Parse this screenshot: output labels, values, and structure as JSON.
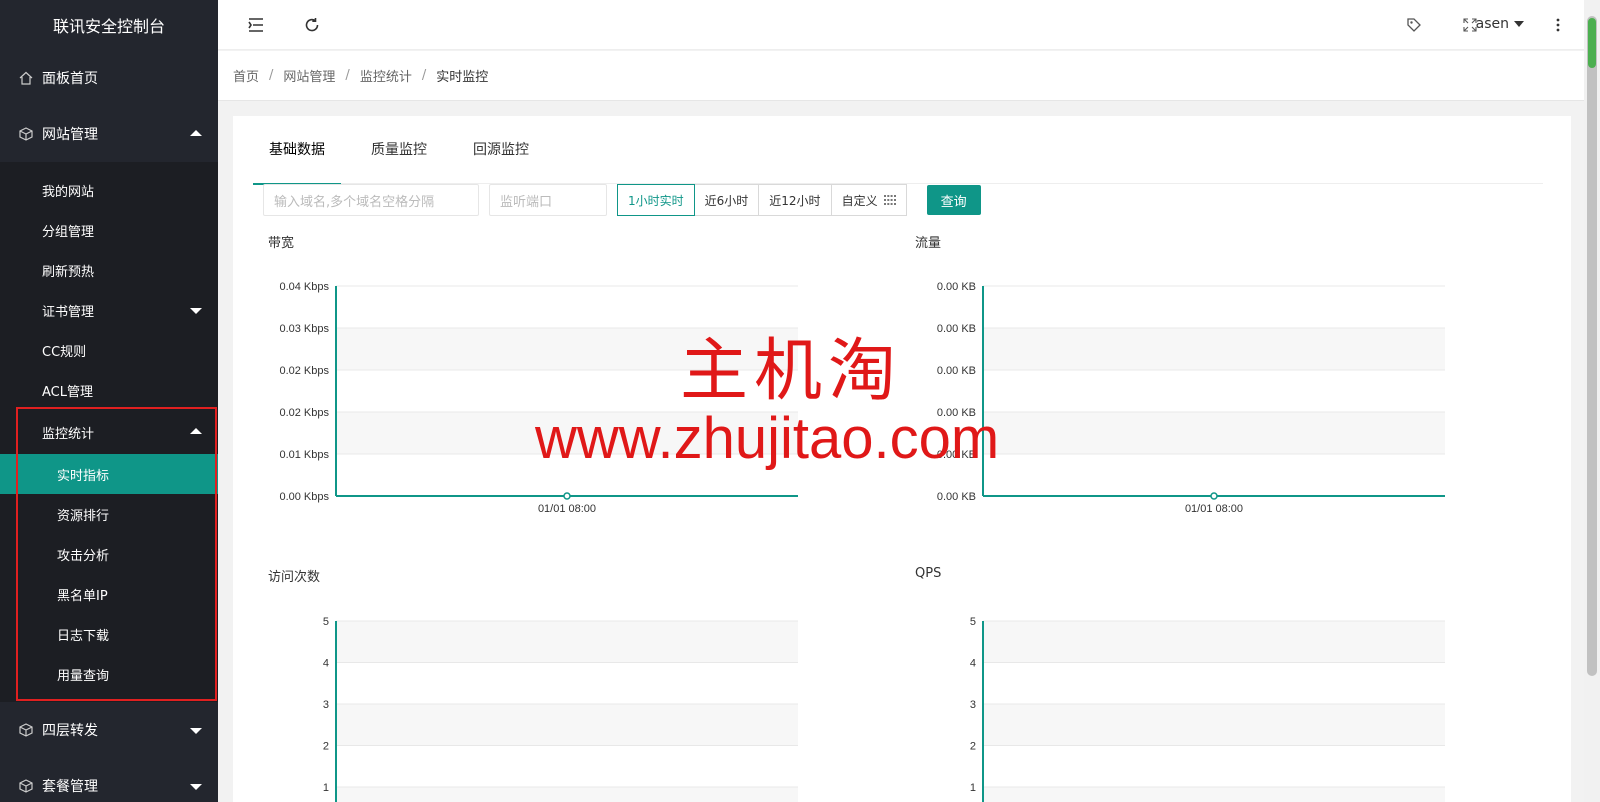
{
  "app_title": "联讯安全控制台",
  "sidebar": {
    "items": [
      {
        "label": "面板首页"
      },
      {
        "label": "网站管理"
      },
      {
        "label": "四层转发"
      },
      {
        "label": "套餐管理"
      }
    ],
    "website_sub": [
      {
        "label": "我的网站"
      },
      {
        "label": "分组管理"
      },
      {
        "label": "刷新预热"
      },
      {
        "label": "证书管理"
      },
      {
        "label": "CC规则"
      },
      {
        "label": "ACL管理"
      }
    ],
    "monitor_group": {
      "label": "监控统计"
    },
    "monitor_sub": [
      {
        "label": "实时指标"
      },
      {
        "label": "资源排行"
      },
      {
        "label": "攻击分析"
      },
      {
        "label": "黑名单IP"
      },
      {
        "label": "日志下载"
      },
      {
        "label": "用量查询"
      }
    ]
  },
  "header": {
    "user": "asen"
  },
  "breadcrumb": [
    "首页",
    "网站管理",
    "监控统计",
    "实时监控"
  ],
  "tabs": [
    "基础数据",
    "质量监控",
    "回源监控"
  ],
  "filters": {
    "domain_placeholder": "输入域名,多个域名空格分隔",
    "port_placeholder": "监听端口",
    "ranges": [
      "1小时实时",
      "近6小时",
      "近12小时",
      "自定义"
    ],
    "query_label": "查询"
  },
  "colors": {
    "accent": "#0f9688",
    "sidebar": "#23262e",
    "watermark": "#e01818"
  },
  "watermark": {
    "line1": "主机淘",
    "line2": "www.zhujitao.com"
  },
  "chart_data": [
    {
      "type": "line",
      "title": "带宽",
      "x": [
        "01/01 08:00"
      ],
      "yticks": [
        "0.00 Kbps",
        "0.01 Kbps",
        "0.02 Kbps",
        "0.02 Kbps",
        "0.03 Kbps",
        "0.04 Kbps"
      ],
      "values": [
        0
      ]
    },
    {
      "type": "line",
      "title": "流量",
      "x": [
        "01/01 08:00"
      ],
      "yticks": [
        "0.00 KB",
        "0.00 KB",
        "0.00 KB",
        "0.00 KB",
        "0.00 KB",
        "0.00 KB"
      ],
      "values": [
        0
      ]
    },
    {
      "type": "line",
      "title": "访问次数",
      "x": [],
      "yticks": [
        "1",
        "2",
        "3",
        "4",
        "5"
      ],
      "values": []
    },
    {
      "type": "line",
      "title": "QPS",
      "x": [],
      "yticks": [
        "1",
        "2",
        "3",
        "4",
        "5"
      ],
      "values": []
    }
  ]
}
